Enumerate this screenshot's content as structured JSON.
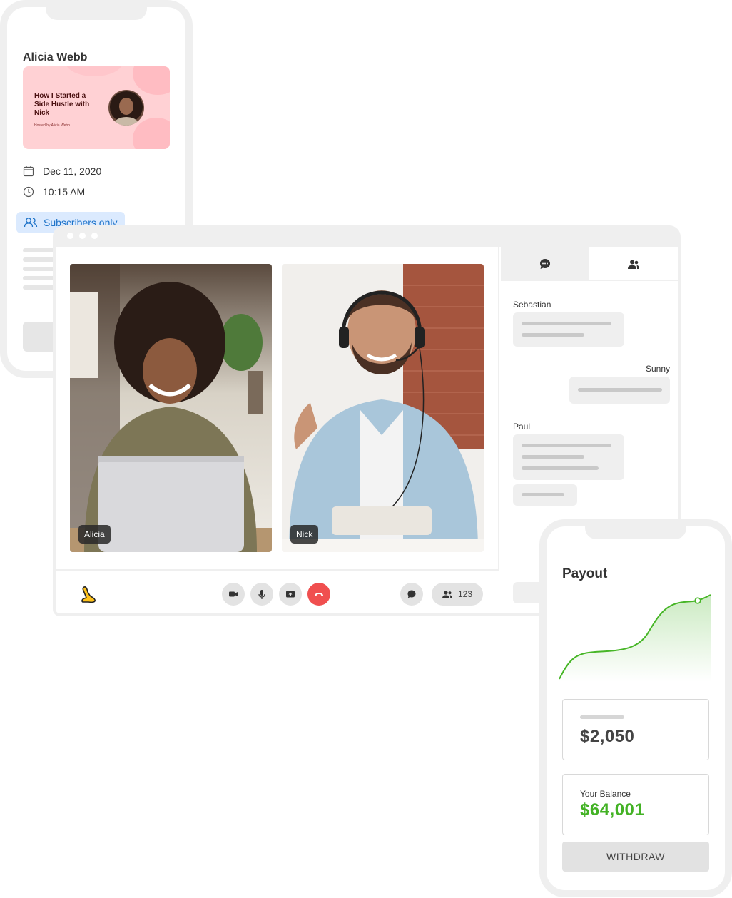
{
  "event_phone": {
    "host_name": "Alicia Webb",
    "card": {
      "title": "How I Started a Side Hustle with Nick",
      "hosted_by": "Hosted by Alicia Webb"
    },
    "date": "Dec 11, 2020",
    "time": "10:15 AM",
    "access_badge": "Subscribers only",
    "icons": [
      "calendar-icon",
      "clock-icon",
      "users-icon"
    ]
  },
  "video_call": {
    "participants": [
      {
        "name": "Alicia"
      },
      {
        "name": "Nick"
      }
    ],
    "controls": [
      "camera-icon",
      "microphone-icon",
      "share-screen-icon",
      "end-call-icon",
      "chat-icon"
    ],
    "participant_count": "123",
    "chat": {
      "tabs": [
        "chat-icon",
        "people-icon"
      ],
      "messages": [
        {
          "sender": "Sebastian"
        },
        {
          "sender": "Sunny"
        },
        {
          "sender": "Paul"
        }
      ]
    },
    "colors": {
      "end_call": "#f04f4f"
    }
  },
  "payout_phone": {
    "title": "Payout",
    "amount": "$2,050",
    "balance_label": "Your Balance",
    "balance": "$64,001",
    "withdraw_label": "WITHDRAW",
    "colors": {
      "balance": "#43b225",
      "chart_line": "#47b627"
    }
  }
}
